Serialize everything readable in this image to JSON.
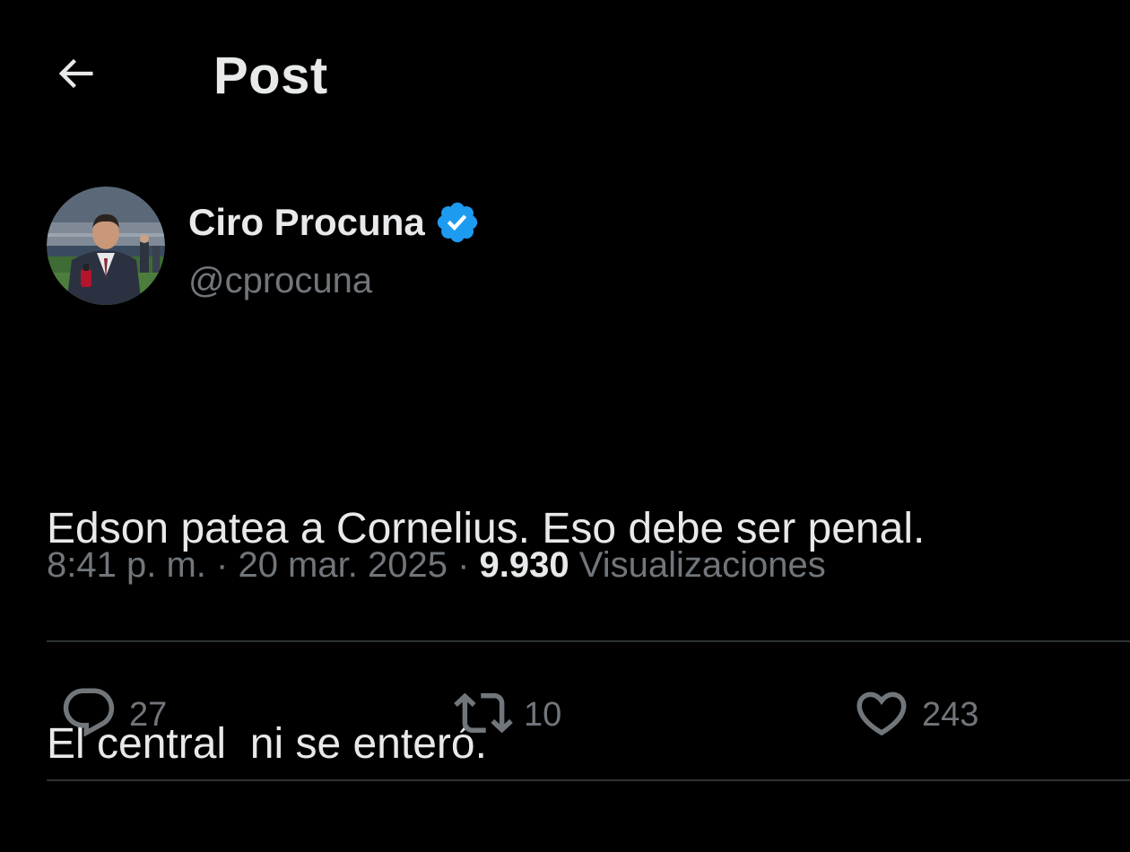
{
  "header": {
    "back_icon": "arrow-left-icon",
    "title": "Post"
  },
  "post": {
    "author": {
      "display_name": "Ciro Procuna",
      "handle": "@cprocuna",
      "verified": true,
      "verified_color": "#1d9bf0"
    },
    "text_lines": [
      "Edson patea a Cornelius. Eso debe ser penal.",
      "El central  ni se enteró."
    ],
    "time": "8:41 p. m.",
    "date": "20 mar. 2025",
    "separator": "·",
    "views_count": "9.930",
    "views_label": "Visualizaciones"
  },
  "actions": {
    "reply": {
      "icon": "reply-icon",
      "count": "27"
    },
    "repost": {
      "icon": "repost-icon",
      "count": "10"
    },
    "like": {
      "icon": "heart-icon",
      "count": "243"
    }
  },
  "colors": {
    "background": "#000000",
    "primary_text": "#e7e9ea",
    "secondary_text": "#71767b",
    "divider": "#2f3336"
  }
}
